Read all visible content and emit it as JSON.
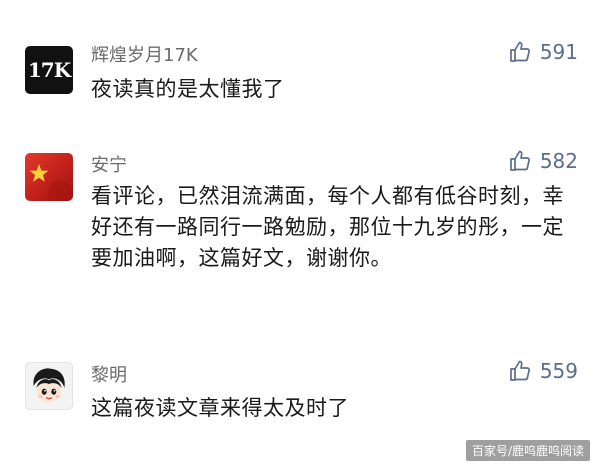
{
  "comments": [
    {
      "username": "辉煌岁月17K",
      "avatar_text": "17K",
      "likes": "591",
      "text": "夜读真的是太懂我了"
    },
    {
      "username": "安宁",
      "likes": "582",
      "text": "看评论，已然泪流满面，每个人都有低谷时刻，幸好还有一路同行一路勉励，那位十九岁的彤，一定要加油啊，这篇好文，谢谢你。"
    },
    {
      "username": "黎明",
      "likes": "559",
      "text": "这篇夜读文章来得太及时了"
    }
  ],
  "watermark": "百家号/鹿呜鹿呜阅读",
  "icons": {
    "like": "thumbs-up-icon"
  },
  "colors": {
    "like_accent": "#5a6e8c",
    "username": "#6b6b6b"
  }
}
